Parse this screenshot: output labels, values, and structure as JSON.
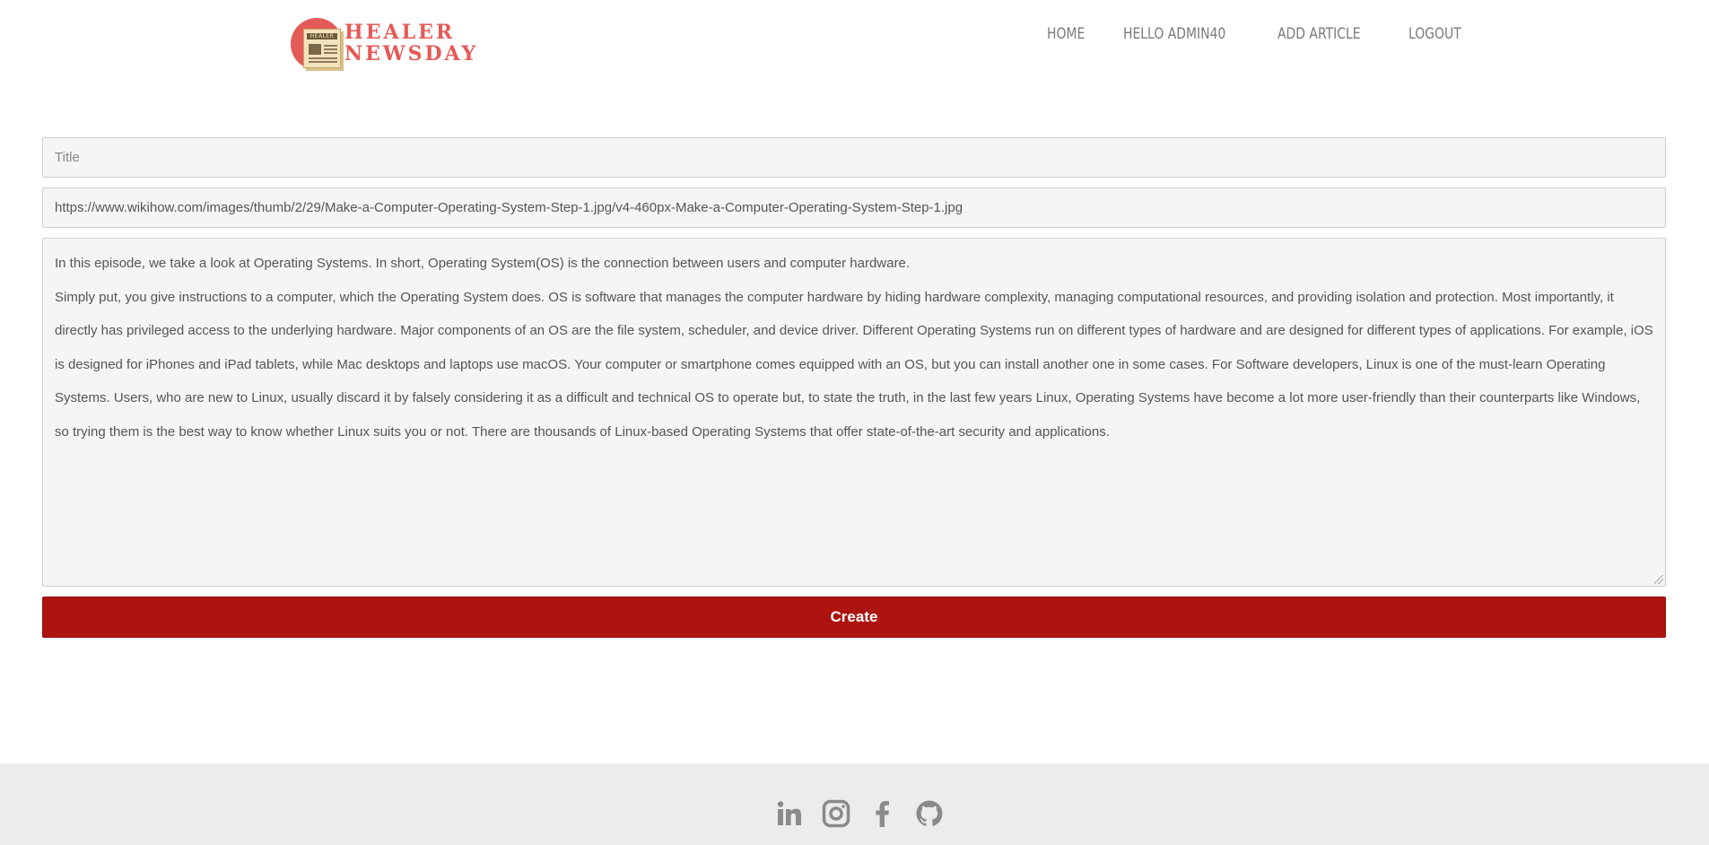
{
  "header": {
    "logo": {
      "line1": "HEALER",
      "line2": "NEWSDAY",
      "paper_heading": "HEALER"
    },
    "nav": [
      {
        "label": "HOME"
      },
      {
        "label": "HELLO ADMIN40"
      },
      {
        "label": "ADD ARTICLE"
      },
      {
        "label": "LOGOUT"
      }
    ]
  },
  "form": {
    "title": {
      "placeholder": "Title",
      "value": ""
    },
    "image_url": {
      "value": "https://www.wikihow.com/images/thumb/2/29/Make-a-Computer-Operating-System-Step-1.jpg/v4-460px-Make-a-Computer-Operating-System-Step-1.jpg"
    },
    "content": {
      "line1": "In this episode, we take a look at Operating Systems. In short, Operating System(OS) is the connection between users and computer hardware.",
      "line2": "Simply put, you give instructions to a computer, which the Operating System does. OS is software that manages the computer hardware by hiding hardware complexity, managing computational resources, and providing isolation and protection. Most importantly, it directly has privileged access to the underlying hardware. Major components of an OS are the file system, scheduler, and device driver. Different Operating Systems run on different types of hardware and are designed for different types of applications. For example, iOS is designed for iPhones and iPad tablets, while Mac desktops and laptops use macOS. Your computer or smartphone comes equipped with an OS, but you can install another one in some cases. For Software developers, Linux is one of the must-learn Operating Systems. Users, who are new to Linux, usually discard it by falsely considering it as a difficult and technical OS to operate but, to state the truth, in the last few years Linux, Operating Systems have become a lot more user-friendly than their counterparts like Windows, so trying them is the best way to know whether Linux suits you or not. There are thousands of Linux-based Operating Systems that offer state-of-the-art security and applications."
    },
    "submit_label": "Create"
  },
  "footer": {
    "social_icons": [
      "linkedin-icon",
      "instagram-icon",
      "facebook-icon",
      "github-icon"
    ]
  },
  "colors": {
    "brand": "#e45a57",
    "button": "#ae140f",
    "nav_text": "#7a7a7a",
    "footer_bg": "#ececec",
    "icon": "#8a8a8a"
  }
}
